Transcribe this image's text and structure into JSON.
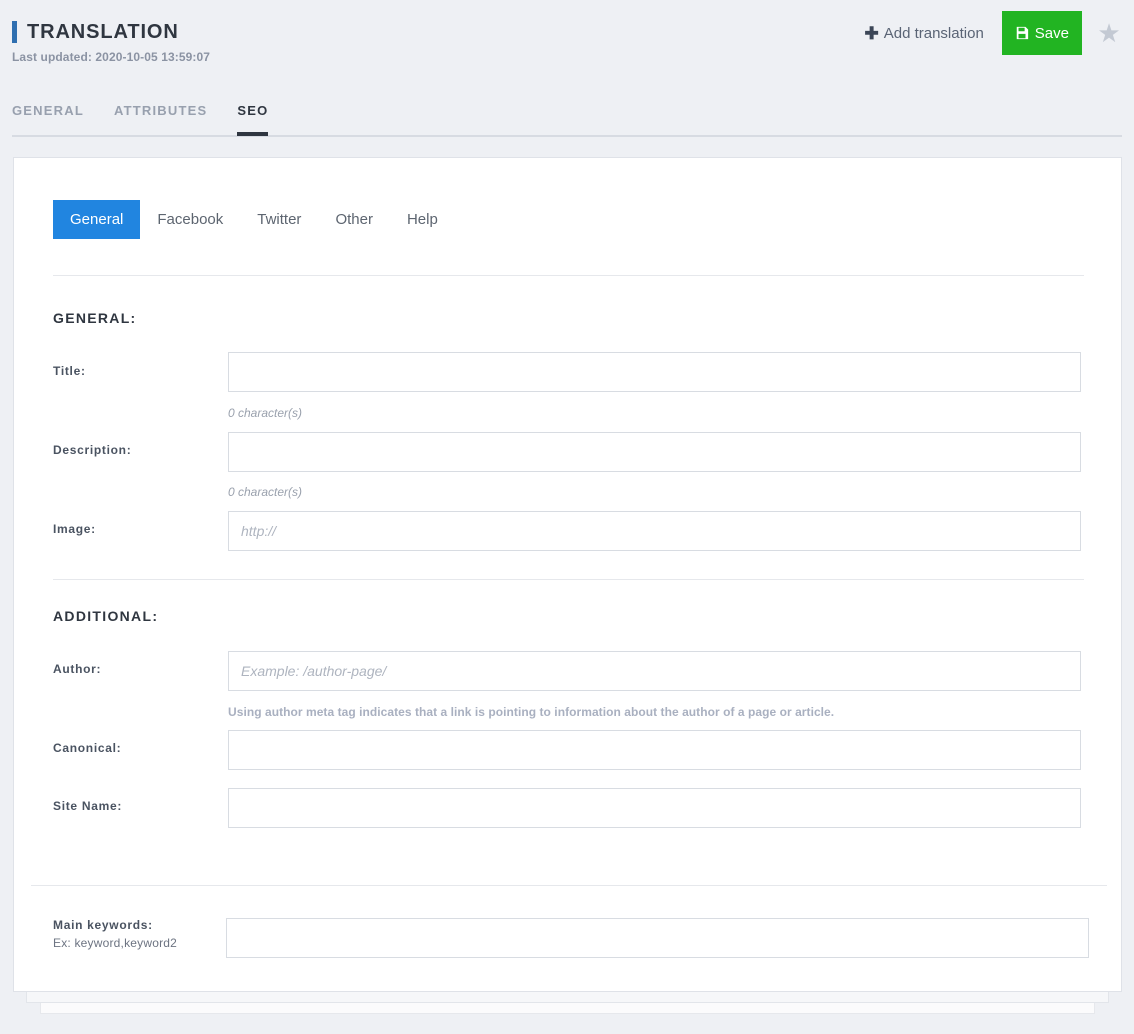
{
  "header": {
    "title": "TRANSLATION",
    "last_updated": "Last updated: 2020-10-05 13:59:07",
    "add_translation_label": "Add translation",
    "plus_icon": "plus-icon",
    "save_label": "Save",
    "save_icon": "floppy-disk-icon",
    "star_icon": "star-icon",
    "accent_color": "#2f6fb0",
    "save_color": "#22b422"
  },
  "main_tabs": [
    {
      "label": "GENERAL",
      "active": false
    },
    {
      "label": "ATTRIBUTES",
      "active": false
    },
    {
      "label": "SEO",
      "active": true
    }
  ],
  "inner_tabs": [
    {
      "label": "General",
      "active": true
    },
    {
      "label": "Facebook",
      "active": false
    },
    {
      "label": "Twitter",
      "active": false
    },
    {
      "label": "Other",
      "active": false
    },
    {
      "label": "Help",
      "active": false
    }
  ],
  "sections": {
    "general": {
      "title": "GENERAL:",
      "fields": {
        "title": {
          "label": "Title:",
          "value": "",
          "placeholder": "",
          "char_count": "0 character(s)"
        },
        "description": {
          "label": "Description:",
          "value": "",
          "placeholder": "",
          "char_count": "0 character(s)"
        },
        "image": {
          "label": "Image:",
          "value": "",
          "placeholder": "http://"
        }
      }
    },
    "additional": {
      "title": "ADDITIONAL:",
      "fields": {
        "author": {
          "label": "Author:",
          "value": "",
          "placeholder": "Example: /author-page/",
          "help": "Using author meta tag indicates that a link is pointing to information about the author of a page or article."
        },
        "canonical": {
          "label": "Canonical:",
          "value": "",
          "placeholder": ""
        },
        "site_name": {
          "label": "Site Name:",
          "value": "",
          "placeholder": ""
        }
      }
    },
    "keywords": {
      "label": "Main keywords:",
      "sublabel": "Ex: keyword,keyword2",
      "value": "",
      "placeholder": ""
    }
  }
}
